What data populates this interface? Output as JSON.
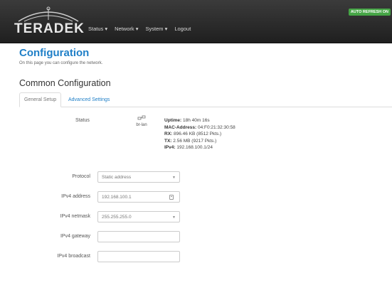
{
  "header": {
    "brand": "TERADEK",
    "nav": [
      "Status ▾",
      "Network ▾",
      "System ▾",
      "Logout"
    ],
    "auto_refresh": "AUTO REFRESH ON"
  },
  "page": {
    "title": "Configuration",
    "subtitle": "On this page you can configure the network.",
    "section_title": "Common Configuration",
    "tabs": [
      {
        "label": "General Setup"
      },
      {
        "label": "Advanced Settings"
      }
    ]
  },
  "status": {
    "label": "Status",
    "iface_name": "br-lan",
    "uptime_key": "Uptime:",
    "uptime_val": "18h 40m 16s",
    "mac_key": "MAC-Address:",
    "mac_val": "04:F0:21:32:30:58",
    "rx_key": "RX:",
    "rx_val": "896.46 KB (8512 Pkts.)",
    "tx_key": "TX:",
    "tx_val": "2.56 MB (9217 Pkts.)",
    "ipv4_key": "IPv4:",
    "ipv4_val": "192.168.100.1/24"
  },
  "form": {
    "protocol_label": "Protocol",
    "protocol_value": "Static address",
    "ipv4_address_label": "IPv4 address",
    "ipv4_address_value": "192.168.100.1",
    "ipv4_netmask_label": "IPv4 netmask",
    "ipv4_netmask_value": "255.255.255.0",
    "ipv4_gateway_label": "IPv4 gateway",
    "ipv4_gateway_value": "",
    "ipv4_broadcast_label": "IPv4 broadcast",
    "ipv4_broadcast_value": ""
  }
}
